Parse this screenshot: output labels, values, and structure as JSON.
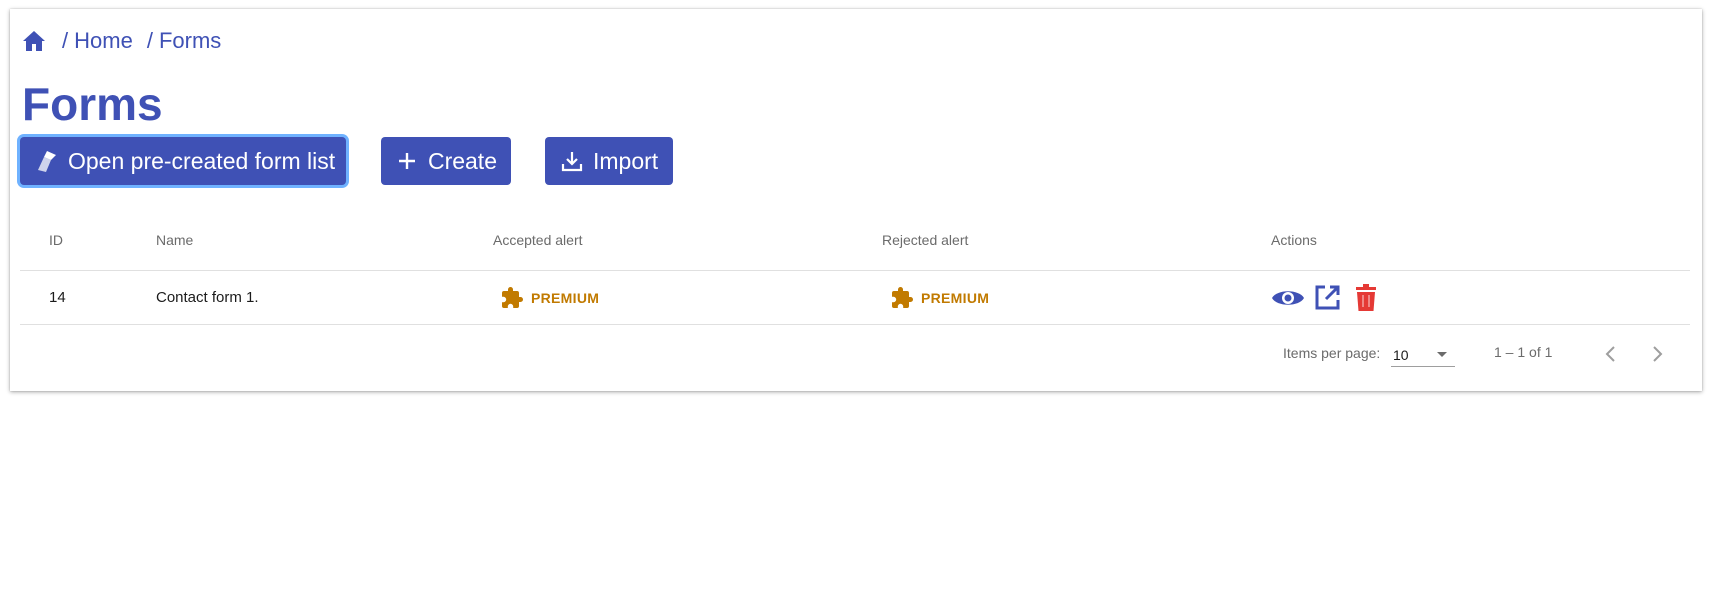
{
  "breadcrumb": {
    "home_icon": "home-icon",
    "items": [
      "Home",
      "Forms"
    ],
    "separator": "/"
  },
  "page": {
    "title": "Forms"
  },
  "toolbar": {
    "open_label": "Open pre-created form list",
    "open_icon": "eraser-icon",
    "create_label": "Create",
    "create_icon": "plus-icon",
    "import_label": "Import",
    "import_icon": "download-icon"
  },
  "table": {
    "columns": [
      "ID",
      "Name",
      "Accepted alert",
      "Rejected alert",
      "Actions"
    ],
    "rows": [
      {
        "id": "14",
        "name": "Contact form 1.",
        "accepted": "PREMIUM",
        "rejected": "PREMIUM"
      }
    ]
  },
  "paginator": {
    "label": "Items per page:",
    "page_size": "10",
    "range": "1 – 1 of 1"
  },
  "colors": {
    "primary": "#3f51b5",
    "premium": "#c17a00",
    "danger": "#e53935",
    "focus_ring": "#6fb2ff"
  }
}
